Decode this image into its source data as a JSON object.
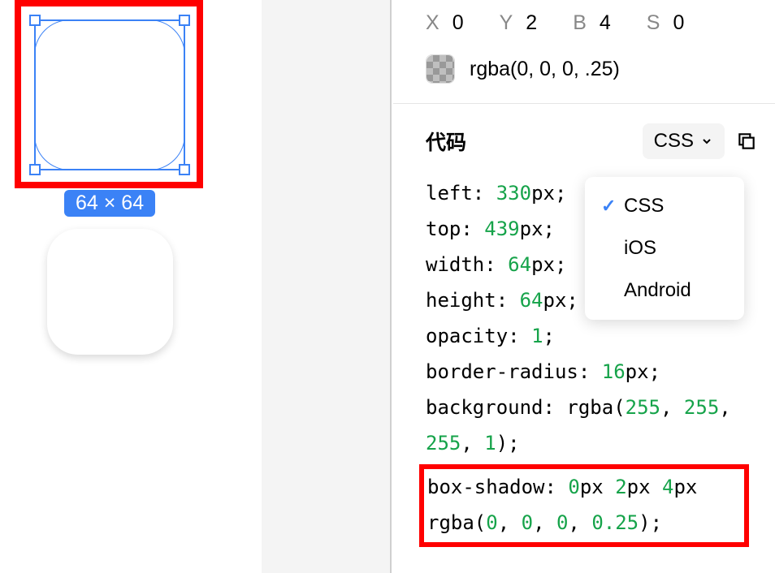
{
  "canvas": {
    "size_badge": "64 × 64"
  },
  "shadow_params": {
    "x_label": "X",
    "x_value": "0",
    "y_label": "Y",
    "y_value": "2",
    "b_label": "B",
    "b_value": "4",
    "s_label": "S",
    "s_value": "0",
    "color_text": "rgba(0, 0, 0, .25)"
  },
  "code_section": {
    "title": "代码",
    "lang_selected": "CSS",
    "lang_options": [
      "CSS",
      "iOS",
      "Android"
    ]
  },
  "css_props": {
    "left": {
      "key": "left",
      "val": "330",
      "unit": "px"
    },
    "top": {
      "key": "top",
      "val": "439",
      "unit": "px"
    },
    "width": {
      "key": "width",
      "val": "64",
      "unit": "px"
    },
    "height": {
      "key": "height",
      "val": "64",
      "unit": "px"
    },
    "opacity": {
      "key": "opacity",
      "val": "1"
    },
    "border_radius": {
      "key": "border-radius",
      "val": "16",
      "unit": "px"
    },
    "background": {
      "key": "background",
      "fn": "rgba",
      "r": "255",
      "g": "255",
      "b": "255",
      "a": "1"
    },
    "box_shadow": {
      "key": "box-shadow",
      "x": "0",
      "y": "2",
      "blur": "4",
      "fn": "rgba",
      "r": "0",
      "g": "0",
      "b": "0",
      "a": "0.25"
    }
  }
}
